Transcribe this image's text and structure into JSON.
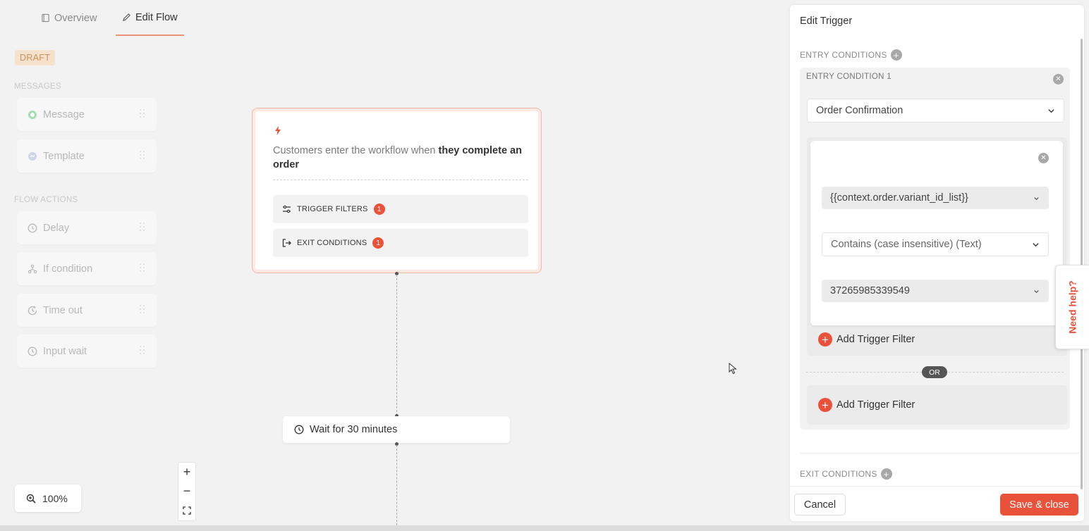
{
  "tabs": [
    {
      "label": "Overview",
      "icon": "book-icon",
      "active": false
    },
    {
      "label": "Edit Flow",
      "icon": "pencil-icon",
      "active": true
    }
  ],
  "status_badge": "DRAFT",
  "palette": {
    "messages_label": "MESSAGES",
    "message_items": [
      {
        "label": "Message",
        "icon": "whatsapp-icon"
      },
      {
        "label": "Template",
        "icon": "messenger-icon"
      }
    ],
    "flow_actions_label": "FLOW ACTIONS",
    "action_items": [
      {
        "label": "Delay",
        "icon": "clock-icon"
      },
      {
        "label": "If condition",
        "icon": "branch-icon"
      },
      {
        "label": "Time out",
        "icon": "timeout-icon"
      },
      {
        "label": "Input wait",
        "icon": "clock-icon"
      }
    ]
  },
  "trigger_node": {
    "description_prefix": "Customers enter the workflow when ",
    "description_bold": "they complete an order",
    "filters_label": "TRIGGER FILTERS",
    "filters_count": "1",
    "exit_label": "EXIT CONDITIONS",
    "exit_count": "1"
  },
  "wait_node": {
    "label": "Wait for 30 minutes"
  },
  "zoom": {
    "level": "100%",
    "zoom_in": "+",
    "zoom_out": "−"
  },
  "panel": {
    "title": "Edit Trigger",
    "entry_conditions_label": "ENTRY CONDITIONS",
    "entry_condition_title": "ENTRY CONDITION 1",
    "event_select": "Order Confirmation",
    "filter": {
      "field": "{{context.order.variant_id_list}}",
      "operator": "Contains (case insensitive) (Text)",
      "value": "37265985339549"
    },
    "add_filter_label": "Add Trigger Filter",
    "or_label": "OR",
    "add_filter_label_2": "Add Trigger Filter",
    "exit_conditions_label": "EXIT CONDITIONS",
    "cancel_label": "Cancel",
    "save_label": "Save & close"
  },
  "help_tab": {
    "label": "Need help?"
  },
  "colors": {
    "accent": "#e8523a",
    "draft_bg": "#f5e2cc",
    "draft_text": "#c9915a"
  }
}
